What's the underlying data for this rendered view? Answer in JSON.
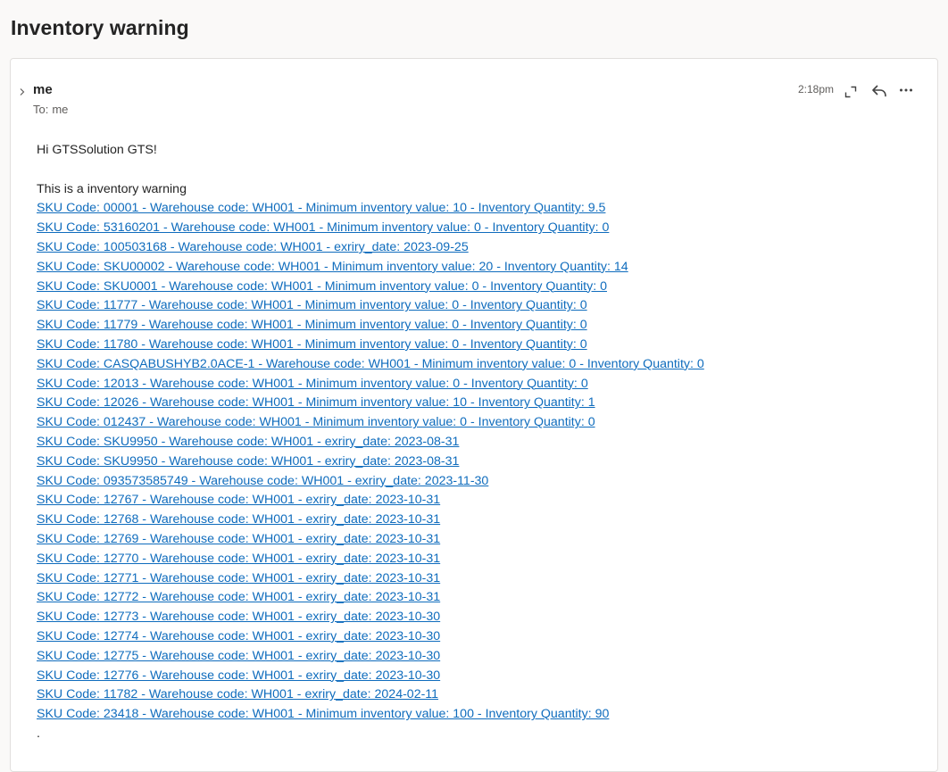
{
  "email": {
    "subject": "Inventory warning",
    "sender": "me",
    "to_prefix": "To:",
    "to_name": "me",
    "time": "2:18pm",
    "greeting": "Hi GTSSolution GTS!",
    "intro": "This is a inventory warning",
    "trailing": ".",
    "sku_lines": [
      "SKU Code: 00001 - Warehouse code: WH001 - Minimum inventory value: 10 - Inventory Quantity: 9.5",
      "SKU Code: 53160201 - Warehouse code: WH001 - Minimum inventory value: 0 - Inventory Quantity: 0",
      "SKU Code: 100503168 - Warehouse code: WH001 - exriry_date: 2023-09-25",
      "SKU Code: SKU00002 - Warehouse code: WH001 - Minimum inventory value: 20 - Inventory Quantity: 14",
      "SKU Code: SKU0001 - Warehouse code: WH001 - Minimum inventory value: 0 - Inventory Quantity: 0",
      "SKU Code: 11777 - Warehouse code: WH001 - Minimum inventory value: 0 - Inventory Quantity: 0",
      "SKU Code: 11779 - Warehouse code: WH001 - Minimum inventory value: 0 - Inventory Quantity: 0",
      "SKU Code: 11780 - Warehouse code: WH001 - Minimum inventory value: 0 - Inventory Quantity: 0",
      "SKU Code: CASQABUSHYB2.0ACE-1 - Warehouse code: WH001 - Minimum inventory value: 0 - Inventory Quantity: 0",
      "SKU Code: 12013 - Warehouse code: WH001 - Minimum inventory value: 0 - Inventory Quantity: 0",
      "SKU Code: 12026 - Warehouse code: WH001 - Minimum inventory value: 10 - Inventory Quantity: 1",
      "SKU Code: 012437 - Warehouse code: WH001 - Minimum inventory value: 0 - Inventory Quantity: 0",
      "SKU Code: SKU9950 - Warehouse code: WH001 - exriry_date: 2023-08-31",
      "SKU Code: SKU9950 - Warehouse code: WH001 - exriry_date: 2023-08-31",
      "SKU Code: 093573585749 - Warehouse code: WH001 - exriry_date: 2023-11-30",
      "SKU Code: 12767 - Warehouse code: WH001 - exriry_date: 2023-10-31",
      "SKU Code: 12768 - Warehouse code: WH001 - exriry_date: 2023-10-31",
      "SKU Code: 12769 - Warehouse code: WH001 - exriry_date: 2023-10-31",
      "SKU Code: 12770 - Warehouse code: WH001 - exriry_date: 2023-10-31",
      "SKU Code: 12771 - Warehouse code: WH001 - exriry_date: 2023-10-31",
      "SKU Code: 12772 - Warehouse code: WH001 - exriry_date: 2023-10-31",
      "SKU Code: 12773 - Warehouse code: WH001 - exriry_date: 2023-10-30",
      "SKU Code: 12774 - Warehouse code: WH001 - exriry_date: 2023-10-30",
      "SKU Code: 12775 - Warehouse code: WH001 - exriry_date: 2023-10-30",
      "SKU Code: 12776 - Warehouse code: WH001 - exriry_date: 2023-10-30",
      "SKU Code: 11782 - Warehouse code: WH001 - exriry_date: 2024-02-11",
      "SKU Code: 23418 - Warehouse code: WH001 - Minimum inventory value: 100 - Inventory Quantity: 90"
    ]
  },
  "icons": {
    "expand": "chevron-right-icon",
    "popout": "expand-window-icon",
    "reply": "reply-icon",
    "more": "more-options-icon"
  },
  "colors": {
    "link": "#0f6cbd",
    "text": "#242424",
    "muted": "#605e5c",
    "background": "#faf9f8",
    "card": "#ffffff"
  }
}
